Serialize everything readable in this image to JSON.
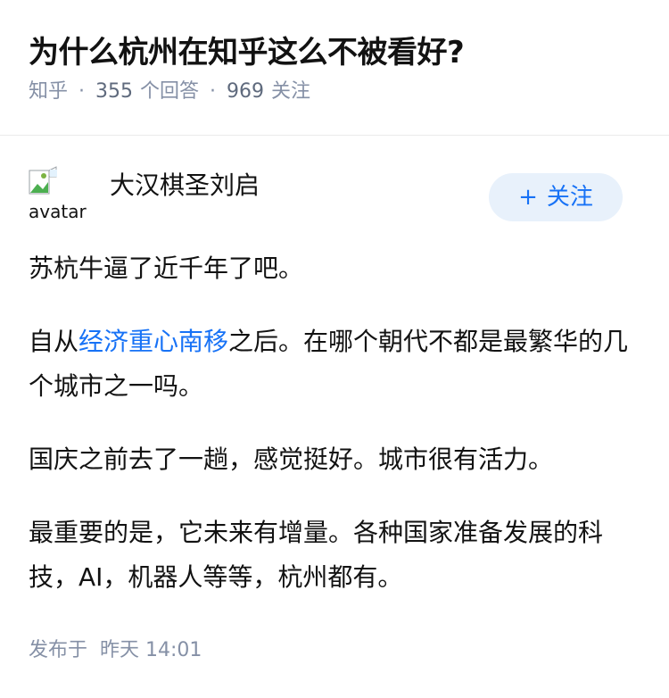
{
  "question": {
    "title": "为什么杭州在知乎这么不被看好?",
    "source": "知乎",
    "answer_count": "355",
    "answer_label": "个回答",
    "follow_count": "969",
    "follow_label": "关注"
  },
  "answer": {
    "avatar_alt": "avatar",
    "author_name": "大汉棋圣刘启",
    "follow_button": {
      "plus": "+",
      "label": "关注"
    },
    "paragraphs": {
      "p1": "苏杭牛逼了近千年了吧。",
      "p2_before": "自从",
      "p2_link": "经济重心南移",
      "p2_after": "之后。在哪个朝代不都是最繁华的几个城市之一吗。",
      "p3": "国庆之前去了一趟，感觉挺好。城市很有活力。",
      "p4": "最重要的是，它未来有增量。各种国家准备发展的科技，AI，机器人等等，杭州都有。"
    },
    "publish_label": "发布于",
    "publish_time": "昨天 14:01"
  },
  "colors": {
    "link": "#1772f6",
    "meta": "#8590a6",
    "follow_bg": "#e8f1fb",
    "text": "#121212"
  },
  "icons": {
    "avatar_broken": "broken-image-icon"
  }
}
